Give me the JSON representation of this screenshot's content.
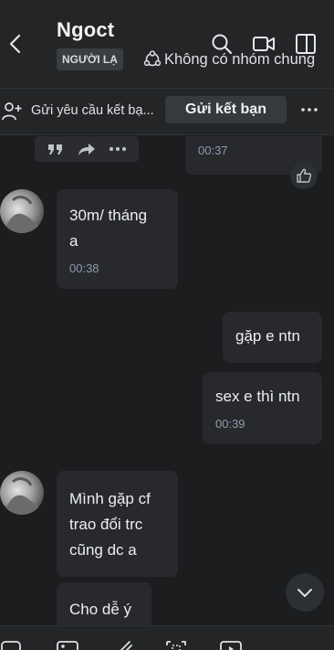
{
  "header": {
    "title": "Ngoct",
    "stranger_badge": "NGƯỜI LẠ",
    "groups_text": "Không có nhóm chung"
  },
  "friend_request": {
    "text": "Gửi yêu cầu kết bạ...",
    "button_label": "Gửi kết bạn"
  },
  "messages": [
    {
      "id": "m0",
      "side": "out",
      "time": "00:37"
    },
    {
      "id": "m1",
      "side": "in",
      "text": "30m/ tháng\na",
      "time": "00:38"
    },
    {
      "id": "m2",
      "side": "out",
      "text": "gặp e ntn"
    },
    {
      "id": "m3",
      "side": "out",
      "text": "sex e thì ntn",
      "time": "00:39"
    },
    {
      "id": "m4",
      "side": "in",
      "text": "Mình gặp cf\ntrao đổi trc\ncũng dc a"
    },
    {
      "id": "m5",
      "side": "in",
      "text": "Cho dễ ý"
    }
  ],
  "colors": {
    "background": "#1b1d1f",
    "header": "#232527",
    "bubble": "#27292c",
    "time": "#8b9bb0"
  }
}
